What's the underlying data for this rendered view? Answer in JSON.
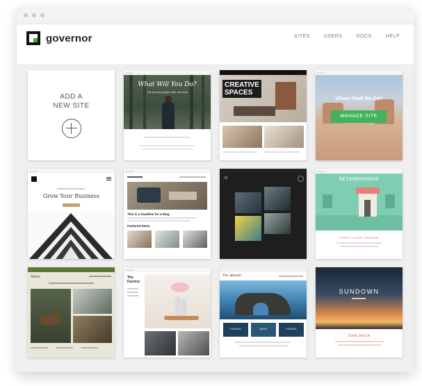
{
  "app": {
    "name": "governor"
  },
  "nav": {
    "items": [
      "SITES",
      "USERS",
      "DOCS",
      "HELP"
    ]
  },
  "add_site": {
    "line1": "ADD A",
    "line2": "NEW SITE"
  },
  "sites": {
    "s1": {
      "title": "What Will You Do?",
      "tagline": "The journey begins with one step"
    },
    "s2": {
      "title": "CREATIVE",
      "title2": "SPACES"
    },
    "s3": {
      "title": "Where Shall We Go?",
      "button": "MANAGE SITE"
    },
    "s4": {
      "title": "Grow Your Business"
    },
    "s5": {
      "heading": "This is a headline for a blog",
      "subheading": "Featured Items"
    },
    "s7": {
      "title": "NEIGHBORHOOD",
      "subtitle": "TAKE A LOOK AROUND"
    },
    "s9": {
      "brand_line1": "The",
      "brand_line2": "Factory"
    },
    "s10": {
      "brand": "The Atlantic",
      "tiles": [
        "TRAVEL",
        "SAVE",
        "TOURS"
      ]
    },
    "s11": {
      "title": "SUNDOWN",
      "footer": "Come Join Us"
    }
  },
  "colors": {
    "accent_green": "#42b35d",
    "logo_green": "#3aa757",
    "page_bg": "#efefef"
  }
}
